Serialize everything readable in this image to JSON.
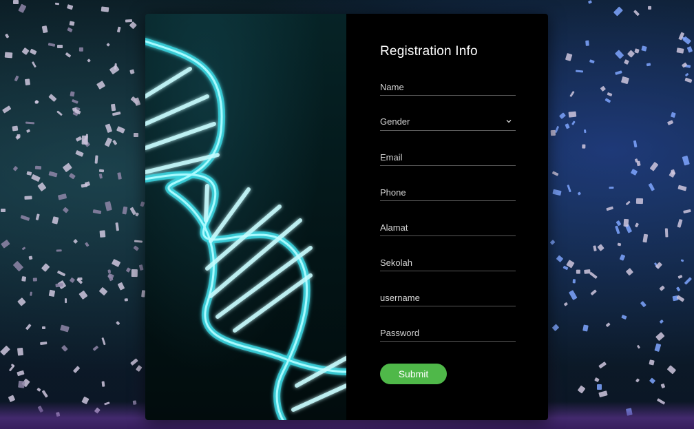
{
  "form": {
    "title": "Registration Info",
    "fields": {
      "name": {
        "placeholder": "Name"
      },
      "gender": {
        "value": "Gender"
      },
      "email": {
        "placeholder": "Email"
      },
      "phone": {
        "placeholder": "Phone"
      },
      "alamat": {
        "placeholder": "Alamat"
      },
      "sekolah": {
        "placeholder": "Sekolah"
      },
      "username": {
        "placeholder": "username"
      },
      "password": {
        "placeholder": "Password"
      }
    },
    "submit_label": "Submit"
  },
  "colors": {
    "submit_bg": "#4fb849",
    "form_bg": "#000000",
    "dna_glow": "#3ee6f0"
  },
  "icons": {
    "gender_dropdown": "chevron-down-icon",
    "illustration": "dna-helix"
  }
}
